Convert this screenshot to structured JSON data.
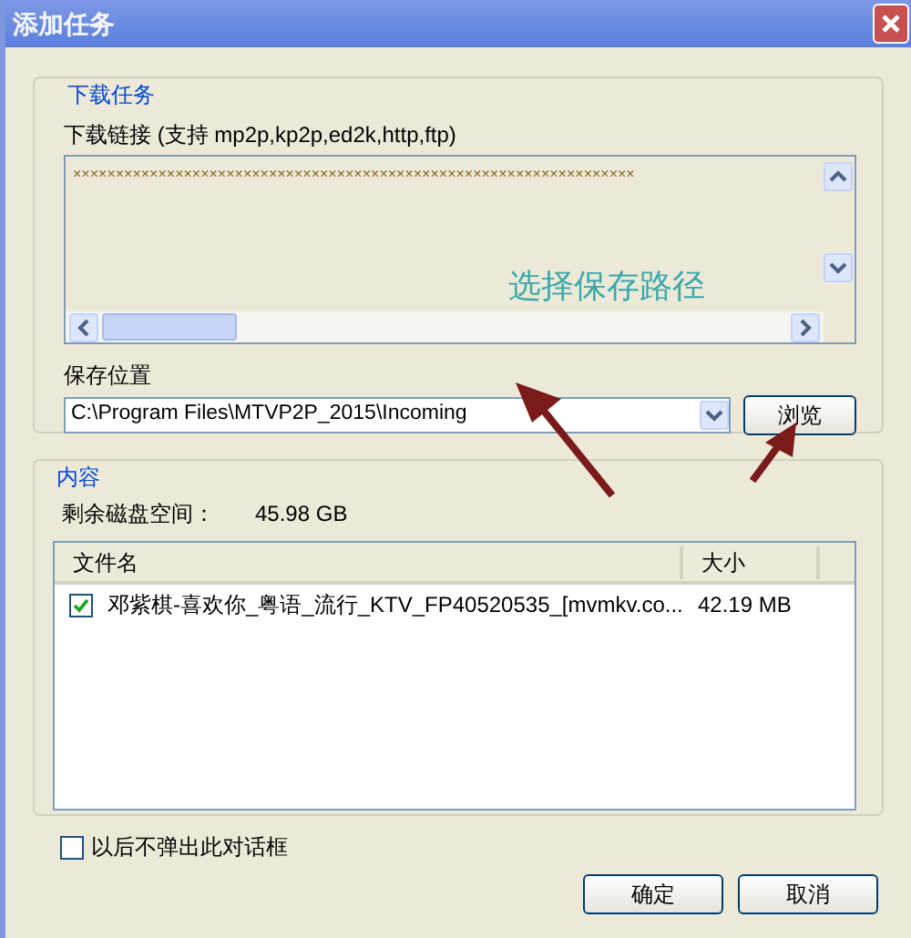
{
  "window": {
    "title": "添加任务"
  },
  "download_task": {
    "legend": "下载任务",
    "link_label": "下载链接 (支持 mp2p,kp2p,ed2k,http,ftp)",
    "link_value": "××××××××××××××××××××××××××××××××××××××××××××××××××××××××××××××××××",
    "save_label": "保存位置",
    "save_path": "C:\\Program Files\\MTVP2P_2015\\Incoming",
    "browse_button": "浏览"
  },
  "annotation": {
    "text": "选择保存路径"
  },
  "content": {
    "legend": "内容",
    "free_space_label": "剩余磁盘空间：",
    "free_space": "45.98 GB",
    "columns": [
      "文件名",
      "大小"
    ],
    "files": [
      {
        "name": "邓紫棋-喜欢你_粤语_流行_KTV_FP40520535_[mvmkv.co...",
        "size": "42.19 MB",
        "checked": true
      }
    ]
  },
  "dont_show_again": {
    "label": "以后不弹出此对话框",
    "checked": false
  },
  "buttons": [
    "确定",
    "取消"
  ]
}
